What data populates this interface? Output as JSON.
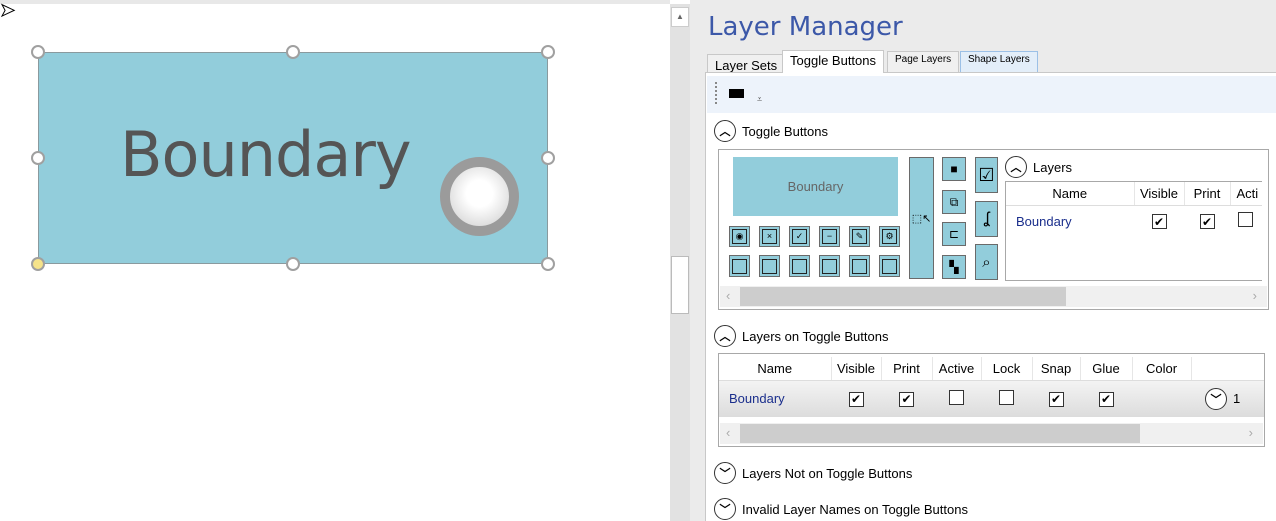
{
  "canvas": {
    "shape_label": "Boundary",
    "shape_fill": "#92cddb"
  },
  "panel": {
    "title": "Layer Manager",
    "title_color": "#3c58a8",
    "tabs": [
      {
        "label": "Layer Sets"
      },
      {
        "label": "Toggle Buttons",
        "active": true
      },
      {
        "label": "Page Layers"
      },
      {
        "label": "Shape Layers"
      }
    ],
    "toggle_section": {
      "header": "Toggle Buttons",
      "preview_label": "Boundary",
      "layers_header": "Layers",
      "layers_columns": [
        "Name",
        "Visible",
        "Print",
        "Acti"
      ],
      "layers_rows": [
        {
          "name": "Boundary",
          "visible": true,
          "print": true,
          "active": false
        }
      ]
    },
    "on_section": {
      "header": "Layers on Toggle Buttons",
      "columns": [
        "Name",
        "Visible",
        "Print",
        "Active",
        "Lock",
        "Snap",
        "Glue",
        "Color"
      ],
      "rows": [
        {
          "name": "Boundary",
          "visible": true,
          "print": true,
          "active": false,
          "lock": false,
          "snap": true,
          "glue": true,
          "count": "1"
        }
      ]
    },
    "not_on_section": {
      "header": "Layers Not on Toggle Buttons"
    },
    "invalid_section": {
      "header": "Invalid Layer Names on Toggle Buttons"
    }
  }
}
